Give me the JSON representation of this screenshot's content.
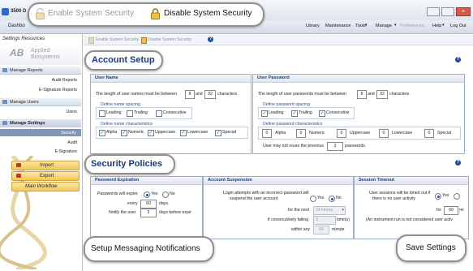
{
  "window": {
    "tab_label": "3500 D",
    "tab2_label": "Dashbo"
  },
  "security_toolbar": {
    "enable_label": "Enable System Security",
    "disable_label": "Disable System Security"
  },
  "menu": {
    "library": "Library",
    "maintenance": "Maintenance",
    "tools": "Tools",
    "manage": "Manage",
    "preferences": "Preferences",
    "help": "Help",
    "logout": "Log Out"
  },
  "sidebar": {
    "title": "Settings Resources",
    "logo_line1": "Applied",
    "logo_line2": "Biosystems",
    "sections": [
      {
        "label": "Manage Reports",
        "items": [
          "Audit Reports",
          "E-Signature Reports"
        ]
      },
      {
        "label": "Manage Users",
        "items": [
          "Users"
        ]
      },
      {
        "label": "Manage Settings",
        "items": [
          "Security",
          "Audit",
          "E-Signature"
        ]
      }
    ],
    "buttons": [
      "Import",
      "Export",
      "Main Workflow"
    ]
  },
  "inner_toolbar": {
    "enable": "Enable System Security",
    "disable": "Disable System Security"
  },
  "account_setup": {
    "title": "Account Setup",
    "user_name": {
      "header": "User Name",
      "length_prefix": "The length of user names must be between",
      "min": "8",
      "and": "and",
      "max": "32",
      "suffix": "characters.",
      "spacing_title": "Define name spacing",
      "spacing": [
        "Leading",
        "Trailing",
        "Consecutive"
      ],
      "chars_title": "Define name characteristics",
      "chars": [
        "Alpha",
        "Numeric",
        "Uppercase",
        "Lowercase",
        "Special"
      ]
    },
    "user_password": {
      "header": "User Password",
      "length_prefix": "The length of user passwords must be between",
      "min": "8",
      "and": "and",
      "max": "32",
      "suffix": "characters.",
      "spacing_title": "Define password spacing",
      "spacing": [
        "Leading",
        "Trailing",
        "Consecutive"
      ],
      "chars_title": "Define password characteristics",
      "chars": [
        {
          "value": "0",
          "label": "Alpha"
        },
        {
          "value": "0",
          "label": "Numeric"
        },
        {
          "value": "0",
          "label": "Uppercase"
        },
        {
          "value": "0",
          "label": "Lowercase"
        },
        {
          "value": "0",
          "label": "Special"
        }
      ],
      "reuse_prefix": "User may not reuse the previous",
      "reuse_value": "3",
      "reuse_suffix": "passwords."
    }
  },
  "security_policies": {
    "title": "Security Policies",
    "password_expiration": {
      "header": "Password Expiration",
      "expire_label": "Passwords will expire",
      "yes": "Yes",
      "no": "No",
      "every_label": "every",
      "every_value": "60",
      "days": "days.",
      "notify_label": "Notify the user",
      "notify_value": "3",
      "notify_suffix": "days before expir"
    },
    "account_suspension": {
      "header": "Account Suspension",
      "line1": "Login attempts with an incorrect password will",
      "line2": "suspend the user account",
      "yes": "Yes",
      "no": "No",
      "next_label": "for the next",
      "next_value": "24 Hours",
      "fail_label": "if consecutively failing",
      "fail_value": "3",
      "fail_suffix": "time(s)",
      "within_label": "within any",
      "within_value": "60",
      "within_suffix": "minute"
    },
    "session_timeout": {
      "header": "Session Timeout",
      "line1": "User sessions will be timed out if",
      "line2": "there is no user activity",
      "yes": "Yes",
      "for_label": "for",
      "for_value": "60",
      "min": "mi",
      "note": "(An instrument run is not considered user activ"
    }
  },
  "callouts": {
    "messaging": "Setup Messaging Notifications",
    "save": "Save Settings"
  },
  "colors": {
    "heading": "#1c3a78",
    "accent": "#f3c659",
    "link_blue": "#2a4f98"
  }
}
